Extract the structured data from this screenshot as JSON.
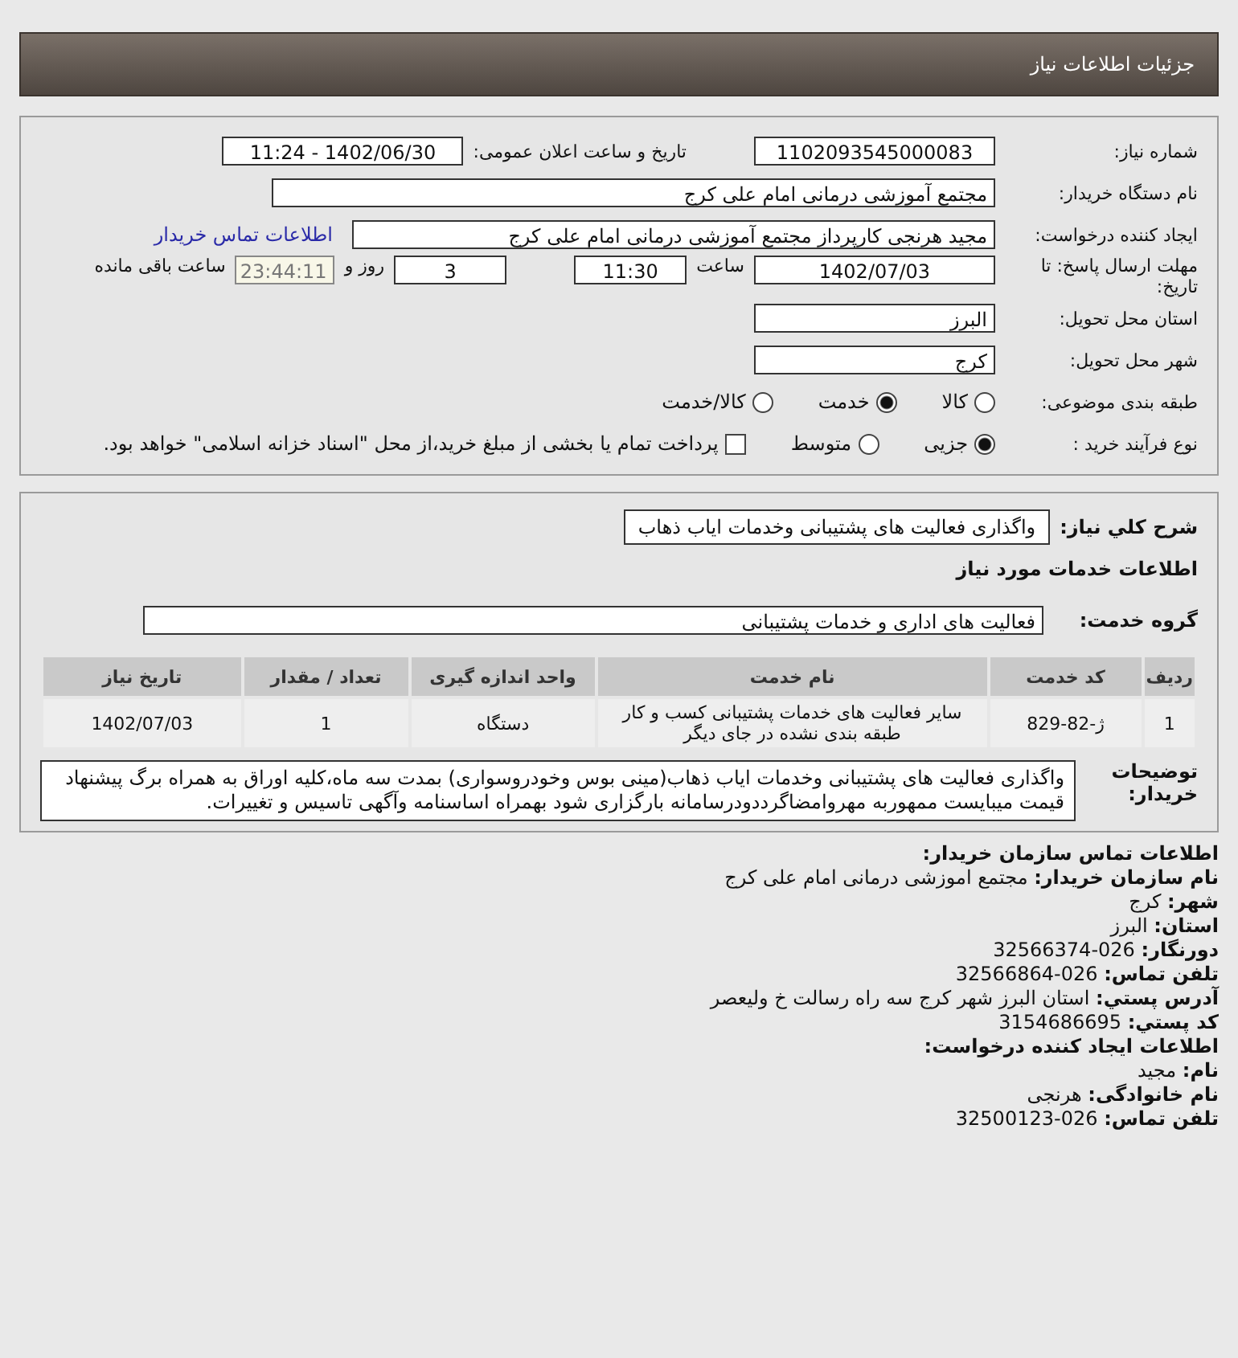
{
  "header": {
    "title": "جزئیات اطلاعات نیاز"
  },
  "details": {
    "need_number": {
      "label": "شماره نیاز:",
      "value": "1102093545000083"
    },
    "announce": {
      "label": "تاریخ و ساعت اعلان عمومی:",
      "value": "1402/06/30 - 11:24"
    },
    "buyer_org": {
      "label": "نام دستگاه خریدار:",
      "value": "مجتمع آموزشی درمانی امام علی کرج"
    },
    "requester": {
      "label": "ایجاد کننده درخواست:",
      "value": "مجید هرنجی کارپرداز مجتمع آموزشی درمانی امام علی کرج",
      "link": "اطلاعات تماس خریدار"
    },
    "deadline": {
      "label": "مهلت ارسال پاسخ: تا تاریخ:",
      "date": "1402/07/03",
      "time_label": "ساعت",
      "time": "11:30",
      "days": "3",
      "days_label": "روز و",
      "remaining": "23:44:11",
      "remaining_label": "ساعت باقی مانده"
    },
    "province": {
      "label": "استان محل تحویل:",
      "value": "البرز"
    },
    "city": {
      "label": "شهر محل تحویل:",
      "value": "کرج"
    },
    "category": {
      "label": "طبقه بندی موضوعی:",
      "options": [
        {
          "label": "کالا",
          "selected": false
        },
        {
          "label": "خدمت",
          "selected": true
        },
        {
          "label": "کالا/خدمت",
          "selected": false
        }
      ]
    },
    "process": {
      "label": "نوع فرآیند خرید :",
      "options": [
        {
          "label": "جزیی",
          "selected": true
        },
        {
          "label": "متوسط",
          "selected": false
        }
      ],
      "checkbox": {
        "label": "پرداخت تمام یا بخشی از مبلغ خرید،از محل \"اسناد خزانه اسلامی\" خواهد بود.",
        "checked": false
      }
    }
  },
  "need": {
    "summary": {
      "label": "شرح کلي نیاز:",
      "value": "واگذاری فعالیت های پشتیبانی وخدمات ایاب ذهاب"
    },
    "services_heading": "اطلاعات خدمات مورد نیاز",
    "service_group": {
      "label": "گروه خدمت:",
      "value": "فعالیت های اداری و خدمات پشتیبانی"
    },
    "table": {
      "columns": [
        "ردیف",
        "کد خدمت",
        "نام خدمت",
        "واحد اندازه گیری",
        "تعداد / مقدار",
        "تاریخ نیاز"
      ],
      "rows": [
        [
          "1",
          "ژ-82-829",
          "سایر فعالیت های خدمات پشتیبانی کسب و کار طبقه بندی نشده در جای دیگر",
          "دستگاه",
          "1",
          "1402/07/03"
        ]
      ]
    },
    "buyer_notes": {
      "label": "توضیحات خریدار:",
      "value": "واگذاری فعالیت های پشتیبانی وخدمات ایاب ذهاب(مینی بوس وخودروسواری) بمدت سه ماه،کلیه اوراق به همراه برگ پیشنهاد قیمت میبایست ممهوربه مهروامضاگرددودرسامانه بارگزاری شود بهمراه اساسنامه وآگهی تاسیس و تغییرات."
    }
  },
  "contact": [
    {
      "kind": "heading",
      "label": "اطلاعات تماس سازمان خریدار:"
    },
    {
      "kind": "field",
      "label": "نام سازمان خریدار:",
      "value": "مجتمع اموزشی درمانی امام علی کرج"
    },
    {
      "kind": "field",
      "label": "شهر:",
      "value": "کرج"
    },
    {
      "kind": "field",
      "label": "استان:",
      "value": "البرز"
    },
    {
      "kind": "field",
      "label": "دورنگار:",
      "value": "026-32566374"
    },
    {
      "kind": "field",
      "label": "تلفن تماس:",
      "value": "026-32566864"
    },
    {
      "kind": "field",
      "label": "آدرس پستي:",
      "value": "استان البرز شهر کرج سه راه رسالت خ ولیعصر"
    },
    {
      "kind": "field",
      "label": "کد پستي:",
      "value": "3154686695"
    },
    {
      "kind": "heading",
      "label": "اطلاعات ایجاد کننده درخواست:"
    },
    {
      "kind": "field",
      "label": "نام:",
      "value": "مجید"
    },
    {
      "kind": "field",
      "label": "نام خانوادگی:",
      "value": "هرنجی"
    },
    {
      "kind": "field",
      "label": "تلفن تماس:",
      "value": "026-32500123"
    }
  ]
}
